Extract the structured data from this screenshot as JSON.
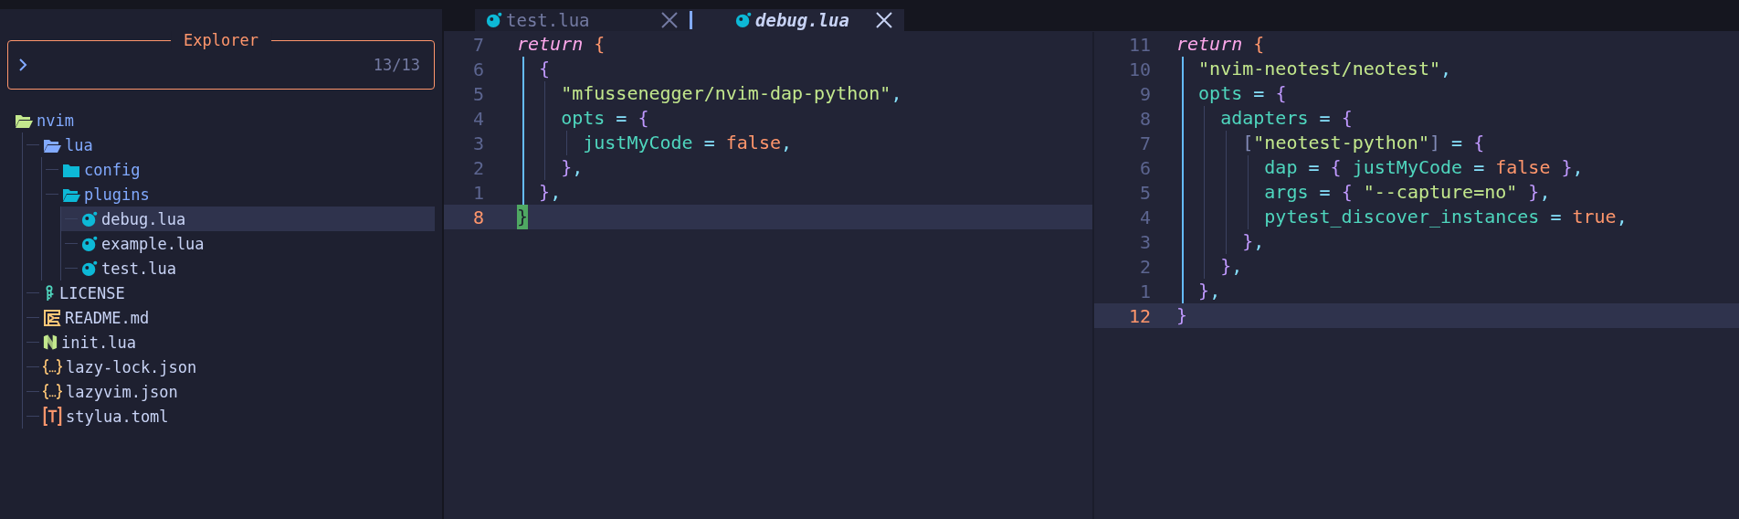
{
  "tabs": [
    {
      "label": "test.lua",
      "selected": false
    },
    {
      "label": "debug.lua",
      "selected": true
    }
  ],
  "explorer": {
    "title": "Explorer",
    "count": "13/13"
  },
  "tree": [
    {
      "name": "nvim",
      "kind": "folder",
      "expanded": true,
      "selected": false,
      "color": "#c3e88d",
      "children": [
        {
          "name": "lua",
          "kind": "folder",
          "expanded": true,
          "selected": false,
          "color": "#82aaff",
          "children": [
            {
              "name": "config",
              "kind": "folder",
              "expanded": false,
              "selected": false,
              "color": "#0db9d7"
            },
            {
              "name": "plugins",
              "kind": "folder",
              "expanded": true,
              "selected": false,
              "color": "#0db9d7",
              "children": [
                {
                  "name": "debug.lua",
                  "kind": "lua",
                  "selected": true,
                  "color": "#0db9d7"
                },
                {
                  "name": "example.lua",
                  "kind": "lua",
                  "selected": false,
                  "color": "#0db9d7"
                },
                {
                  "name": "test.lua",
                  "kind": "lua",
                  "selected": false,
                  "color": "#0db9d7"
                }
              ]
            }
          ]
        },
        {
          "name": "LICENSE",
          "kind": "license",
          "selected": false,
          "color": "#4fd6be"
        },
        {
          "name": "README.md",
          "kind": "markdown",
          "selected": false,
          "color": "#ffc777"
        },
        {
          "name": "init.lua",
          "kind": "neovim",
          "selected": false,
          "color": "#c3e88d"
        },
        {
          "name": "lazy-lock.json",
          "kind": "json",
          "selected": false,
          "color": "#ffc777"
        },
        {
          "name": "lazyvim.json",
          "kind": "json",
          "selected": false,
          "color": "#ffc777"
        },
        {
          "name": "stylua.toml",
          "kind": "toml",
          "selected": false,
          "color": "#ff966c"
        }
      ]
    }
  ],
  "editors": [
    {
      "lines": [
        {
          "number": "7",
          "current": false,
          "tokens": [
            {
              "kind": "keyword",
              "text": "return"
            },
            {
              "kind": "brace_outer",
              "text": " {"
            }
          ]
        },
        {
          "number": "6",
          "current": false,
          "tokens": [
            {
              "kind": "brace",
              "text": "  {"
            }
          ]
        },
        {
          "number": "5",
          "current": false,
          "tokens": [
            {
              "kind": "string",
              "text": "    \"mfussenegger/nvim-dap-python\""
            },
            {
              "kind": "punct",
              "text": ","
            }
          ]
        },
        {
          "number": "4",
          "current": false,
          "tokens": [
            {
              "kind": "key",
              "text": "    opts"
            },
            {
              "kind": "op",
              "text": " ="
            },
            {
              "kind": "brace",
              "text": " {"
            }
          ]
        },
        {
          "number": "3",
          "current": false,
          "tokens": [
            {
              "kind": "key",
              "text": "      justMyCode"
            },
            {
              "kind": "op",
              "text": " ="
            },
            {
              "kind": "bool",
              "text": " false"
            },
            {
              "kind": "punct",
              "text": ","
            }
          ]
        },
        {
          "number": "2",
          "current": false,
          "tokens": [
            {
              "kind": "brace",
              "text": "    }"
            },
            {
              "kind": "punct",
              "text": ","
            }
          ]
        },
        {
          "number": "1",
          "current": false,
          "tokens": [
            {
              "kind": "brace",
              "text": "  }"
            },
            {
              "kind": "punct",
              "text": ","
            }
          ]
        },
        {
          "number": "8",
          "current": true,
          "tokens": [
            {
              "kind": "cursor",
              "text": "}"
            }
          ]
        }
      ]
    },
    {
      "lines": [
        {
          "number": "11",
          "current": false,
          "tokens": [
            {
              "kind": "keyword",
              "text": "return"
            },
            {
              "kind": "brace_outer",
              "text": " {"
            }
          ]
        },
        {
          "number": "10",
          "current": false,
          "tokens": [
            {
              "kind": "string",
              "text": "  \"nvim-neotest/neotest\""
            },
            {
              "kind": "punct",
              "text": ","
            }
          ]
        },
        {
          "number": "9",
          "current": false,
          "tokens": [
            {
              "kind": "key",
              "text": "  opts"
            },
            {
              "kind": "op",
              "text": " ="
            },
            {
              "kind": "brace",
              "text": " {"
            }
          ]
        },
        {
          "number": "8",
          "current": false,
          "tokens": [
            {
              "kind": "key",
              "text": "    adapters"
            },
            {
              "kind": "op",
              "text": " ="
            },
            {
              "kind": "brace",
              "text": " {"
            }
          ]
        },
        {
          "number": "7",
          "current": false,
          "tokens": [
            {
              "kind": "bracket",
              "text": "      ["
            },
            {
              "kind": "string",
              "text": "\"neotest-python\""
            },
            {
              "kind": "bracket",
              "text": "]"
            },
            {
              "kind": "op",
              "text": " ="
            },
            {
              "kind": "brace",
              "text": " {"
            }
          ]
        },
        {
          "number": "6",
          "current": false,
          "tokens": [
            {
              "kind": "key",
              "text": "        dap"
            },
            {
              "kind": "op",
              "text": " ="
            },
            {
              "kind": "brace",
              "text": " {"
            },
            {
              "kind": "key",
              "text": " justMyCode"
            },
            {
              "kind": "op",
              "text": " ="
            },
            {
              "kind": "bool",
              "text": " false"
            },
            {
              "kind": "brace",
              "text": " }"
            },
            {
              "kind": "punct",
              "text": ","
            }
          ]
        },
        {
          "number": "5",
          "current": false,
          "tokens": [
            {
              "kind": "key",
              "text": "        args"
            },
            {
              "kind": "op",
              "text": " ="
            },
            {
              "kind": "brace",
              "text": " {"
            },
            {
              "kind": "string",
              "text": " \"--capture=no\""
            },
            {
              "kind": "brace",
              "text": " }"
            },
            {
              "kind": "punct",
              "text": ","
            }
          ]
        },
        {
          "number": "4",
          "current": false,
          "tokens": [
            {
              "kind": "key",
              "text": "        pytest_discover_instances"
            },
            {
              "kind": "op",
              "text": " ="
            },
            {
              "kind": "bool",
              "text": " true"
            },
            {
              "kind": "punct",
              "text": ","
            }
          ]
        },
        {
          "number": "3",
          "current": false,
          "tokens": [
            {
              "kind": "brace",
              "text": "      }"
            },
            {
              "kind": "punct",
              "text": ","
            }
          ]
        },
        {
          "number": "2",
          "current": false,
          "tokens": [
            {
              "kind": "brace",
              "text": "    }"
            },
            {
              "kind": "punct",
              "text": ","
            }
          ]
        },
        {
          "number": "1",
          "current": false,
          "tokens": [
            {
              "kind": "brace",
              "text": "  }"
            },
            {
              "kind": "punct",
              "text": ","
            }
          ]
        },
        {
          "number": "12",
          "current": true,
          "tokens": [
            {
              "kind": "brace",
              "text": "}"
            }
          ]
        }
      ]
    }
  ]
}
